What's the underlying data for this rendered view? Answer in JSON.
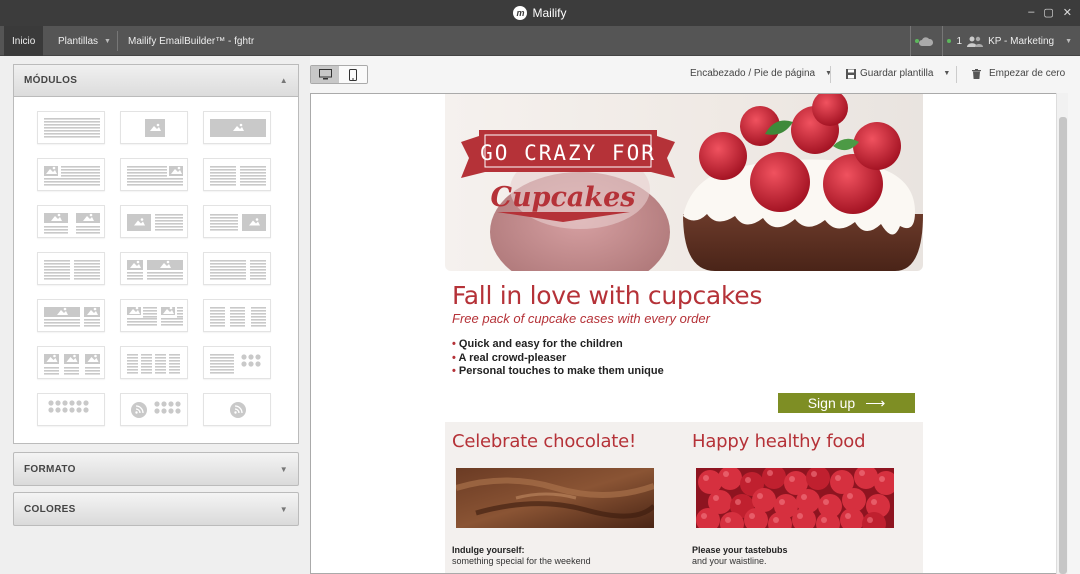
{
  "window": {
    "app_title": "Mailify",
    "controls": [
      "–",
      "▢",
      "✕"
    ]
  },
  "nav": {
    "home": "Inicio",
    "templates": "Plantillas",
    "current": "Mailify EmailBuilder™ - fghtr",
    "user_count": "1",
    "user_label": "KP - Marketing"
  },
  "left": {
    "modules_title": "MÓDULOS",
    "format_title": "FORMATO",
    "colors_title": "COLORES"
  },
  "toolbar": {
    "header_footer": "Encabezado / Pie de página",
    "save_template": "Guardar plantilla",
    "start_over": "Empezar de cero"
  },
  "email": {
    "hero_line1": "GO CRAZY FOR",
    "hero_line2": "Cupcakes",
    "headline": "Fall in love with cupcakes",
    "subheadline": "Free pack of cupcake cases with every order",
    "bullets": [
      "Quick and easy for the children",
      "A real crowd-pleaser",
      "Personal touches to make them unique"
    ],
    "cta": "Sign up",
    "col1": {
      "title": "Celebrate chocolate!",
      "bold": "Indulge yourself:",
      "text": "something special for the weekend"
    },
    "col2": {
      "title": "Happy healthy food",
      "bold": "Please your tastebubs",
      "text": "and your waistline."
    }
  },
  "colors": {
    "brand_red": "#b53238",
    "cta_green": "#7e8e24",
    "titlebar": "#3c3c3c",
    "navbar": "#555555"
  },
  "icons": [
    "mailify-logo-icon",
    "cloud-icon",
    "users-icon",
    "desktop-icon",
    "mobile-icon",
    "floppy-disk-icon",
    "trash-icon",
    "arrow-right-icon"
  ]
}
